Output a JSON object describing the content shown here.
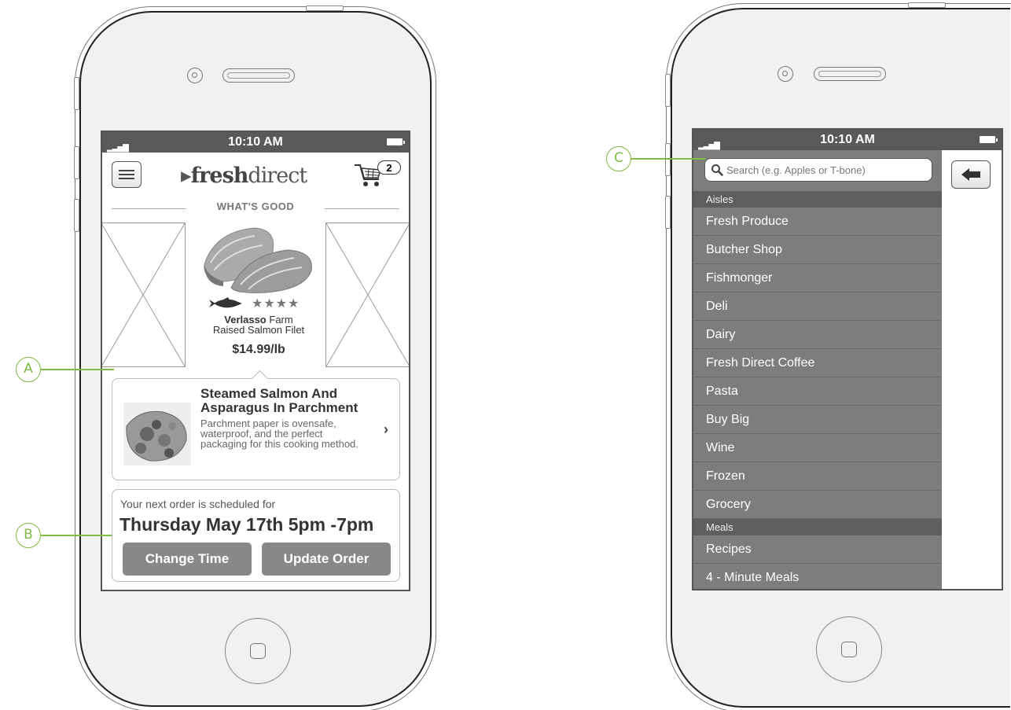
{
  "left_phone": {
    "status_time": "10:10 AM",
    "logo": {
      "prefix": "fresh",
      "suffix": "direct"
    },
    "cart_count": "2",
    "section_title": "WHAT'S GOOD",
    "product": {
      "brand": "Verlasso",
      "name_rest": " Farm",
      "name_line2": "Raised Salmon Filet",
      "price": "$14.99/lb",
      "stars": "★★★★"
    },
    "recipe": {
      "title": "Steamed Salmon And Asparagus In Parchment",
      "description": "Parchment paper is ovensafe, waterproof, and the perfect packaging for this cooking method.",
      "chevron": "›"
    },
    "order": {
      "label": "Your next order is scheduled for",
      "time": "Thursday May 17th 5pm -7pm",
      "change_button": "Change Time",
      "update_button": "Update Order"
    }
  },
  "right_phone": {
    "status_time": "10:10 AM",
    "search": {
      "placeholder": "Search (e.g. Apples or T-bone)"
    },
    "categories": [
      {
        "header": "Aisles",
        "items": [
          "Fresh Produce",
          "Butcher Shop",
          "Fishmonger",
          "Deli",
          "Dairy",
          "Fresh Direct Coffee",
          "Pasta",
          "Buy Big",
          "Wine",
          "Frozen",
          "Grocery"
        ]
      },
      {
        "header": "Meals",
        "items": [
          "Recipes",
          "4 - Minute Meals"
        ]
      }
    ]
  },
  "annotations": {
    "a": "A",
    "b": "B",
    "c": "C"
  },
  "colors": {
    "annotation": "#7dbb42",
    "sidebar": "#7d7d7d",
    "status_bar": "#595959",
    "button": "#888888"
  }
}
